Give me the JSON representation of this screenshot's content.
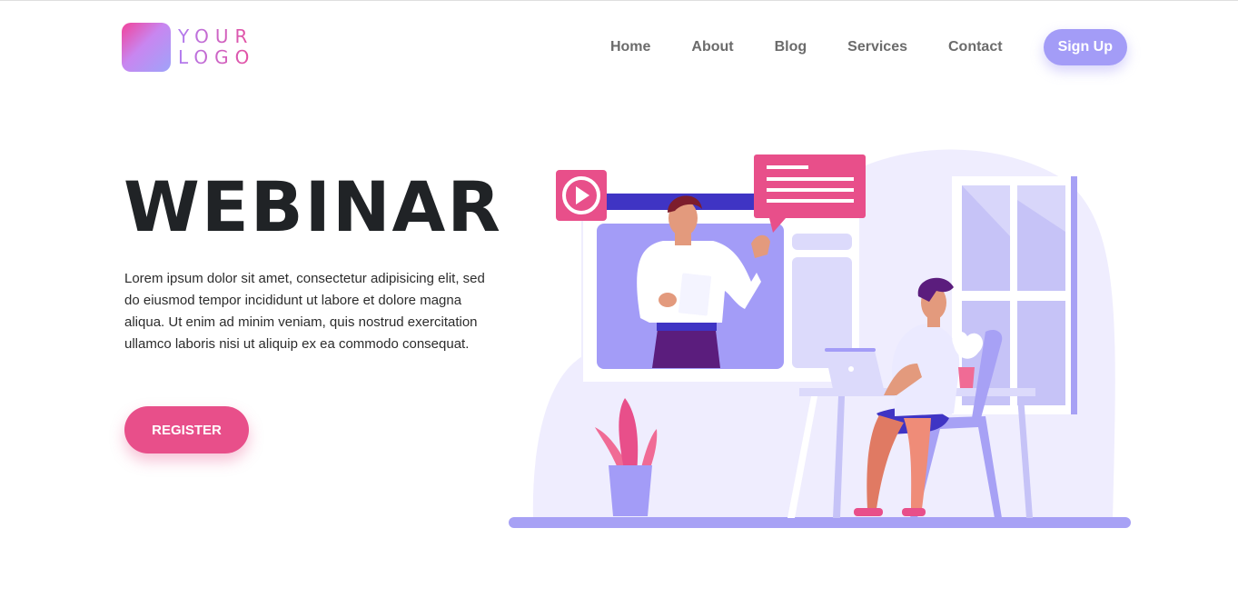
{
  "header": {
    "logo_line1": "YOUR",
    "logo_line2": "LOGO",
    "nav": [
      {
        "label": "Home"
      },
      {
        "label": "About"
      },
      {
        "label": "Blog"
      },
      {
        "label": "Services"
      },
      {
        "label": "Contact"
      }
    ],
    "signup_label": "Sign Up"
  },
  "hero": {
    "title": "WEBINAR",
    "text": "Lorem ipsum dolor sit amet, consectetur adipisicing elit, sed do eiusmod tempor incididunt ut labore et dolore magna aliqua. Ut enim ad minim veniam, quis nostrud exercitation ullamco laboris nisi ut aliquip ex ea commodo consequat.",
    "register_label": "REGISTER"
  },
  "colors": {
    "accent_purple": "#a39cf7",
    "accent_pink": "#e84f8a",
    "title": "#202326"
  }
}
